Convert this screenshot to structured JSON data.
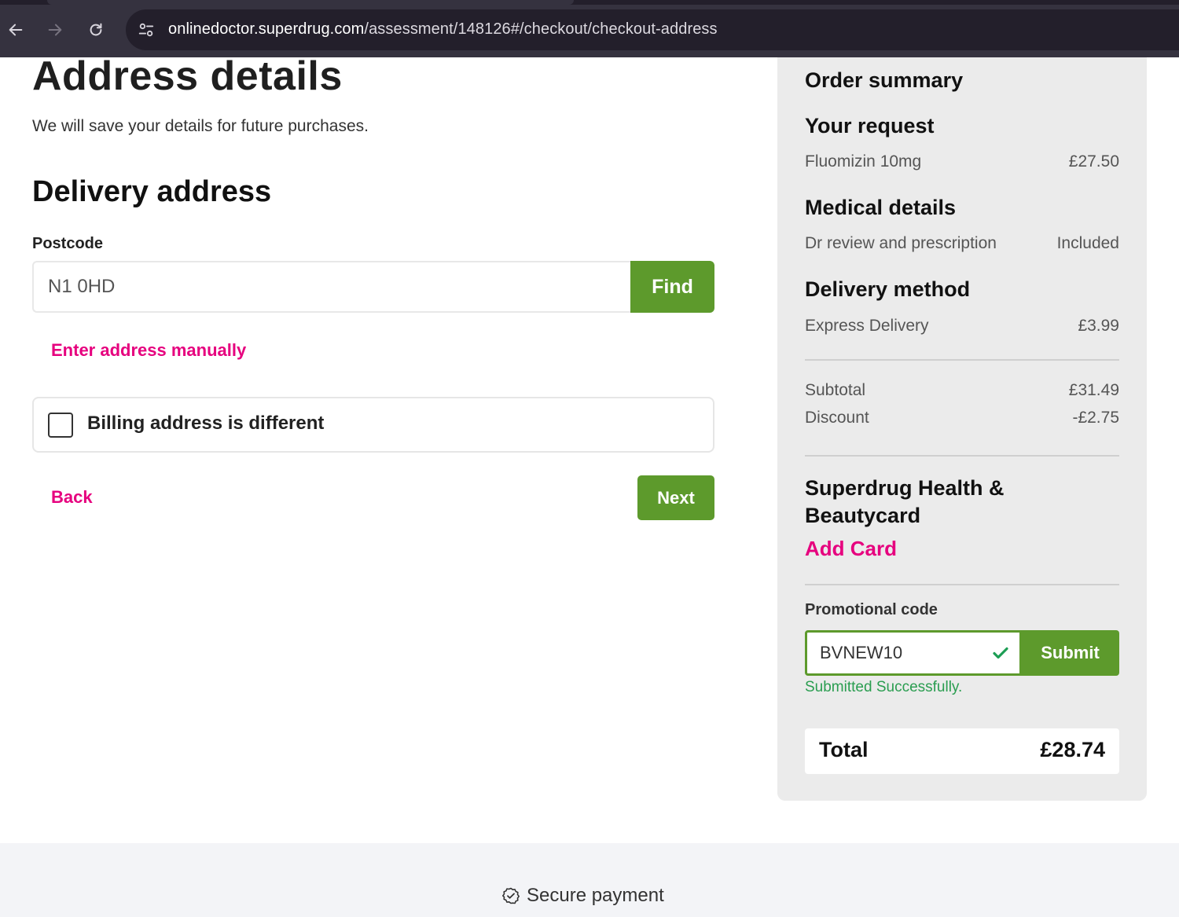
{
  "browser": {
    "url_host": "onlinedoctor.superdrug.com",
    "url_path": "/assessment/148126#/checkout/checkout-address",
    "icons": [
      "back-arrow-icon",
      "forward-arrow-icon",
      "reload-icon",
      "site-settings-icon"
    ]
  },
  "page": {
    "title": "Address details",
    "subtitle": "We will save your details for future purchases.",
    "section_title": "Delivery address"
  },
  "postcode": {
    "label": "Postcode",
    "value": "N1 0HD",
    "find_label": "Find"
  },
  "manual_link": "Enter address manually",
  "billing": {
    "label": "Billing address is different",
    "checked": false
  },
  "nav": {
    "back_label": "Back",
    "next_label": "Next"
  },
  "summary": {
    "title": "Order summary",
    "request_heading": "Your request",
    "request_item": {
      "name": "Fluomizin 10mg",
      "price": "£27.50"
    },
    "medical_heading": "Medical details",
    "medical_item": {
      "name": "Dr review and prescription",
      "price": "Included"
    },
    "delivery_heading": "Delivery method",
    "delivery_item": {
      "name": "Express Delivery",
      "price": "£3.99"
    },
    "subtotal": {
      "label": "Subtotal",
      "value": "£31.49"
    },
    "discount": {
      "label": "Discount",
      "value": "-£2.75"
    },
    "beautycard_heading": "Superdrug Health & Beautycard",
    "add_card_label": "Add Card",
    "promo_label": "Promotional code",
    "promo_value": "BVNEW10",
    "promo_submit": "Submit",
    "promo_status": "Submitted Successfully.",
    "total": {
      "label": "Total",
      "value": "£28.74"
    }
  },
  "footer": {
    "secure_label": "Secure payment"
  },
  "colors": {
    "brand_pink": "#e6007e",
    "button_green": "#5d9a2c",
    "success_green": "#2a9d50",
    "sidebar_bg": "#ebebeb",
    "browser_bar": "#35323f"
  }
}
